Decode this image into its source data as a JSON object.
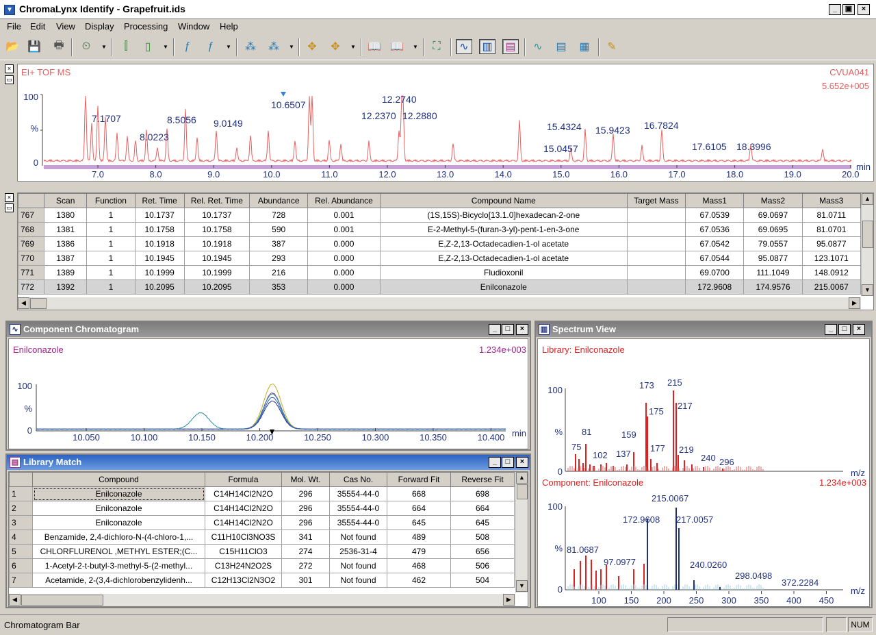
{
  "window": {
    "title": "ChromaLynx Identify - Grapefruit.ids",
    "min": "_",
    "restore": "▣",
    "close": "×"
  },
  "menu": [
    "File",
    "Edit",
    "View",
    "Display",
    "Processing",
    "Window",
    "Help"
  ],
  "tic": {
    "label_left": "EI+ TOF MS",
    "label_right1": "CVUA041",
    "label_right2": "5.652e+005",
    "y_top": "100",
    "y_mid": "%",
    "y_zero": "0",
    "x_unit": "min",
    "x_ticks": [
      "7.0",
      "8.0",
      "9.0",
      "10.0",
      "11.0",
      "12.0",
      "13.0",
      "14.0",
      "15.0",
      "16.0",
      "17.0",
      "18.0",
      "19.0",
      "20.0"
    ],
    "peak_labels": [
      "7.1707",
      "8.0223",
      "8.5056",
      "9.0149",
      "10.6507",
      "12.2740",
      "12.2370",
      "12.2880",
      "15.4324",
      "15.0457",
      "15.9423",
      "16.7824",
      "17.6105",
      "18.3996"
    ]
  },
  "results_table": {
    "headers": [
      "Scan",
      "Function",
      "Ret. Time",
      "Rel. Ret. Time",
      "Abundance",
      "Rel. Abundance",
      "Compound Name",
      "Target Mass",
      "Mass1",
      "Mass2",
      "Mass3"
    ],
    "rows": [
      [
        "767",
        "1380",
        "1",
        "10.1737",
        "10.1737",
        "728",
        "0.001",
        "(1S,15S)-Bicyclo[13.1.0]hexadecan-2-one",
        "",
        "67.0539",
        "69.0697",
        "81.0711"
      ],
      [
        "768",
        "1381",
        "1",
        "10.1758",
        "10.1758",
        "590",
        "0.001",
        "E-2-Methyl-5-(furan-3-yl)-pent-1-en-3-one",
        "",
        "67.0536",
        "69.0695",
        "81.0701"
      ],
      [
        "769",
        "1386",
        "1",
        "10.1918",
        "10.1918",
        "387",
        "0.000",
        "E,Z-2,13-Octadecadien-1-ol acetate",
        "",
        "67.0542",
        "79.0557",
        "95.0877"
      ],
      [
        "770",
        "1387",
        "1",
        "10.1945",
        "10.1945",
        "293",
        "0.000",
        "E,Z-2,13-Octadecadien-1-ol acetate",
        "",
        "67.0544",
        "95.0877",
        "123.1071"
      ],
      [
        "771",
        "1389",
        "1",
        "10.1999",
        "10.1999",
        "216",
        "0.000",
        "Fludioxonil",
        "",
        "69.0700",
        "111.1049",
        "148.0912"
      ],
      [
        "772",
        "1392",
        "1",
        "10.2095",
        "10.2095",
        "353",
        "0.000",
        "Enilconazole",
        "",
        "172.9608",
        "174.9576",
        "215.0067"
      ]
    ]
  },
  "component_chrom": {
    "title": "Component Chromatogram",
    "name": "Enilconazole",
    "intensity": "1.234e+003",
    "y_top": "100",
    "y_mid": "%",
    "y_zero": "0",
    "x_unit": "min",
    "x_ticks": [
      "10.050",
      "10.100",
      "10.150",
      "10.200",
      "10.250",
      "10.300",
      "10.350",
      "10.400"
    ]
  },
  "spectrum": {
    "title": "Spectrum View",
    "library_label": "Library: Enilconazole",
    "component_label": "Component: Enilconazole",
    "component_intensity": "1.234e+003",
    "y_top": "100",
    "y_mid": "%",
    "y_zero": "0",
    "x_unit": "m/z",
    "lib_peak_labels": [
      "75",
      "81",
      "102",
      "137",
      "159",
      "173",
      "175",
      "177",
      "215",
      "217",
      "219",
      "240",
      "296"
    ],
    "comp_peak_labels": [
      "81.0687",
      "97.0977",
      "172.9608",
      "215.0067",
      "217.0057",
      "240.0260",
      "298.0498",
      "372.2284"
    ],
    "x_ticks": [
      "100",
      "150",
      "200",
      "250",
      "300",
      "350",
      "400",
      "450"
    ]
  },
  "library_match": {
    "title": "Library Match",
    "headers": [
      "Compound",
      "Formula",
      "Mol. Wt.",
      "Cas No.",
      "Forward Fit",
      "Reverse Fit"
    ],
    "rows": [
      [
        "1",
        "Enilconazole",
        "C14H14Cl2N2O",
        "296",
        "35554-44-0",
        "668",
        "698"
      ],
      [
        "2",
        "Enilconazole",
        "C14H14Cl2N2O",
        "296",
        "35554-44-0",
        "664",
        "664"
      ],
      [
        "3",
        "Enilconazole",
        "C14H14Cl2N2O",
        "296",
        "35554-44-0",
        "645",
        "645"
      ],
      [
        "4",
        "Benzamide, 2,4-dichloro-N-(4-chloro-1,...",
        "C11H10Cl3NO3S",
        "341",
        "Not found",
        "489",
        "508"
      ],
      [
        "5",
        " CHLORFLURENOL ,METHYL ESTER;(C...",
        "C15H11ClO3",
        "274",
        "2536-31-4",
        "479",
        "656"
      ],
      [
        "6",
        "1-Acetyl-2-t-butyl-3-methyl-5-(2-methyl...",
        "C13H24N2O2S",
        "272",
        "Not found",
        "468",
        "506"
      ],
      [
        "7",
        "Acetamide, 2-(3,4-dichlorobenzylidenh...",
        "C12H13Cl2N3O2",
        "301",
        "Not found",
        "462",
        "504"
      ]
    ]
  },
  "status": {
    "text": "Chromatogram Bar",
    "num": "NUM"
  }
}
